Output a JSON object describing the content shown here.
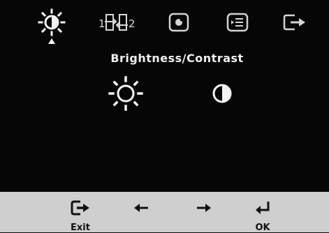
{
  "osd": {
    "panel_title": "Brightness/Contrast",
    "top_tabs": [
      {
        "icon": "brightness-contrast-icon",
        "selected": true
      },
      {
        "icon": "image-position-icon",
        "label_left": "1",
        "label_right": "2"
      },
      {
        "icon": "image-properties-icon"
      },
      {
        "icon": "options-icon"
      },
      {
        "icon": "exit-icon"
      }
    ],
    "options": [
      {
        "icon": "brightness-icon"
      },
      {
        "icon": "contrast-icon"
      }
    ],
    "bottom_bar": {
      "exit_label": "Exit",
      "ok_label": "OK"
    }
  }
}
